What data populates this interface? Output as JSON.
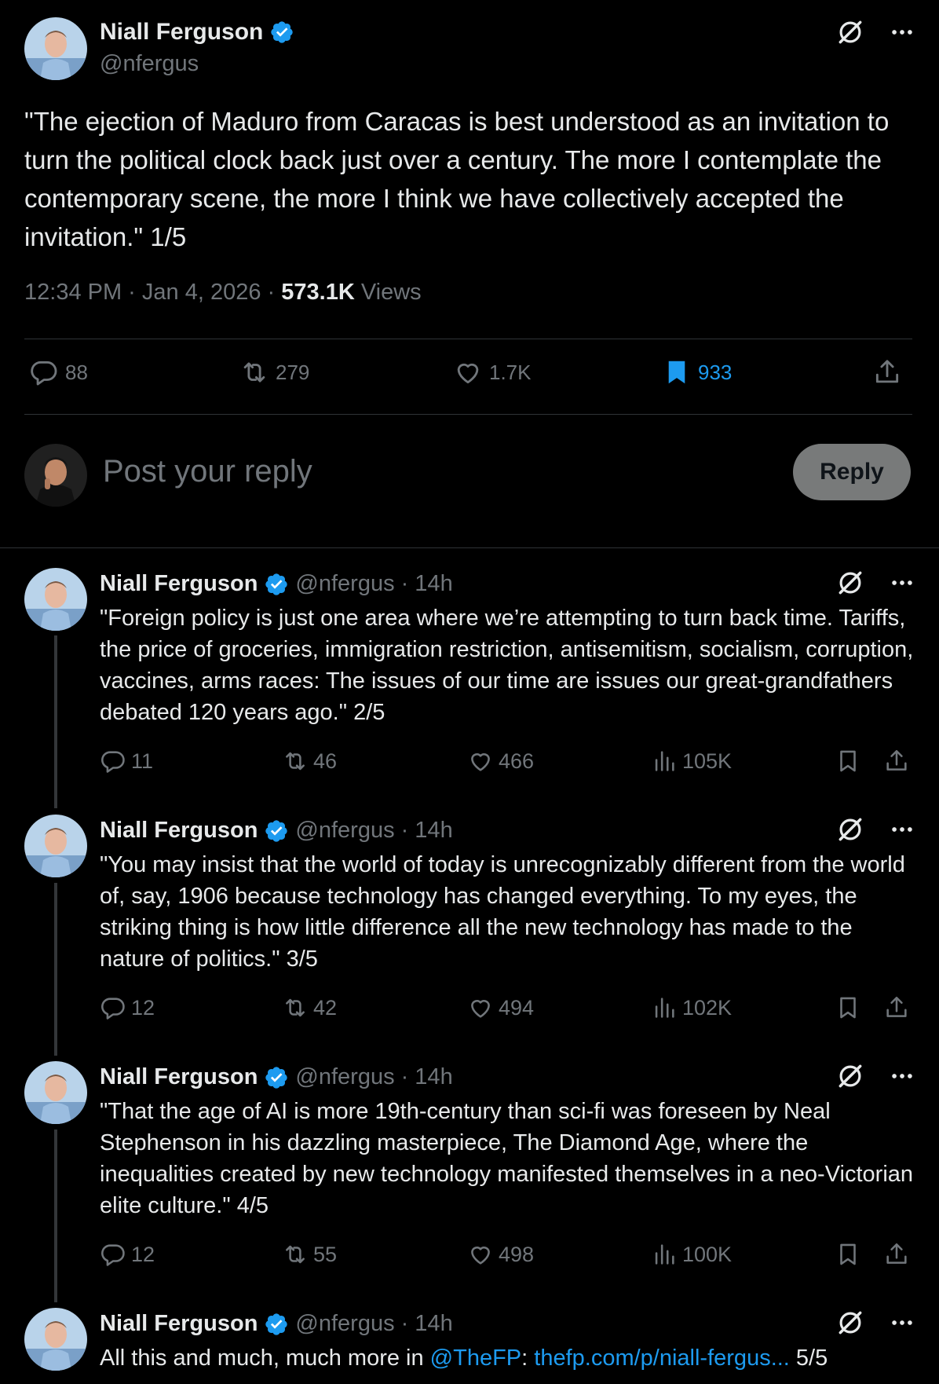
{
  "main_post": {
    "author_name": "Niall Ferguson",
    "handle": "@nfergus",
    "text": "\"The ejection of Maduro from Caracas is best understood as an invitation to turn the political clock back just over a century. The more I contemplate the contemporary scene, the more I think we have collectively accepted the invitation.\" 1/5",
    "time": "12:34 PM · Jan 4, 2026 ·",
    "views": "573.1K",
    "views_label": "Views",
    "replies": "88",
    "reposts": "279",
    "likes": "1.7K",
    "bookmarks": "933"
  },
  "composer": {
    "placeholder": "Post your reply",
    "reply_label": "Reply"
  },
  "thread": [
    {
      "author_name": "Niall Ferguson",
      "handle": "@nfergus",
      "time": "· 14h",
      "text": "\"Foreign policy is just one area where we’re attempting to turn back time. Tariffs, the price of groceries, immigration restriction, antisemitism, socialism, corruption, vaccines, arms races: The issues of our time are issues our great-grandfathers debated 120 years ago.\" 2/5",
      "replies": "11",
      "reposts": "46",
      "likes": "466",
      "views": "105K"
    },
    {
      "author_name": "Niall Ferguson",
      "handle": "@nfergus",
      "time": "· 14h",
      "text": "\"You may insist that the world of today is unrecognizably different from the world of, say, 1906 because technology has changed everything. To my eyes, the striking thing is how little difference all the new technology has made to the nature of politics.\" 3/5",
      "replies": "12",
      "reposts": "42",
      "likes": "494",
      "views": "102K"
    },
    {
      "author_name": "Niall Ferguson",
      "handle": "@nfergus",
      "time": "· 14h",
      "text": "\"That the age of AI is more 19th-century than sci-fi was foreseen by Neal Stephenson in his dazzling masterpiece, The Diamond Age, where the inequalities created by new technology manifested themselves in a neo-Victorian elite culture.\" 4/5",
      "replies": "12",
      "reposts": "55",
      "likes": "498",
      "views": "100K"
    },
    {
      "author_name": "Niall Ferguson",
      "handle": "@nfergus",
      "time": "· 14h",
      "text_prefix": "All this and much, much more in ",
      "mention": "@TheFP",
      "colon": ": ",
      "link": "thefp.com/p/niall-fergus...",
      "suffix": " 5/5"
    }
  ],
  "colors": {
    "accent": "#1d9bf0",
    "muted": "#71767b",
    "text": "#e7e9ea",
    "background": "#000000"
  }
}
